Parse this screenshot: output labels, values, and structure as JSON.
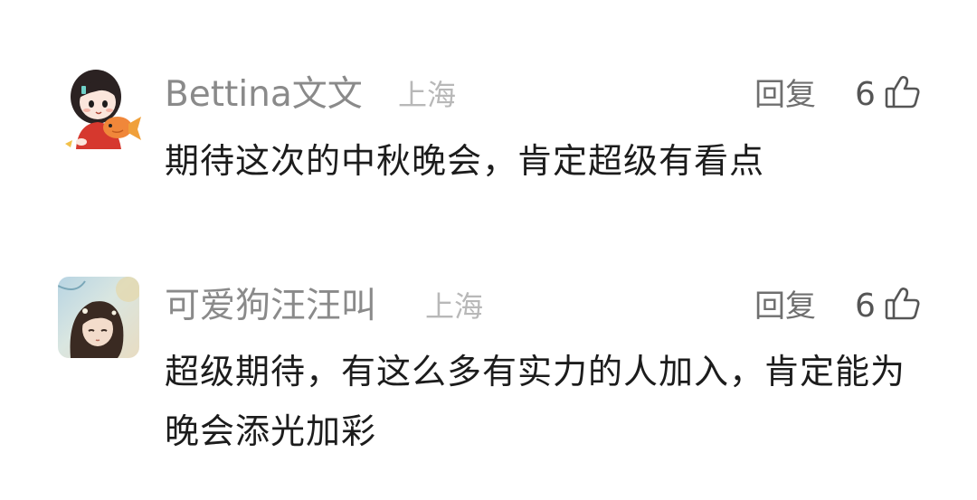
{
  "comments": [
    {
      "username": "Bettina文文",
      "location": "上海",
      "reply_label": "回复",
      "like_count": "6",
      "text": "期待这次的中秋晚会，肯定超级有看点"
    },
    {
      "username": "可爱狗汪汪叫",
      "location": "上海",
      "reply_label": "回复",
      "like_count": "6",
      "text": "超级期待，有这么多有实力的人加入，肯定能为晚会添光加彩"
    }
  ],
  "icons": {
    "like": "thumbs-up-icon"
  },
  "colors": {
    "username": "#8a8a8a",
    "location": "#b8b8b8",
    "body_text": "#1c1c1c",
    "reply": "#6f6f6f"
  }
}
